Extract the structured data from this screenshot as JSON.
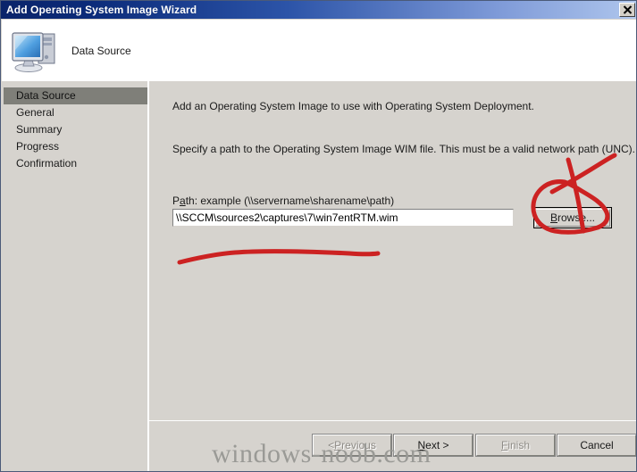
{
  "window": {
    "title": "Add Operating System Image Wizard",
    "close_icon": "close-x-icon"
  },
  "header": {
    "icon": "computer-monitor-icon",
    "title": "Data Source"
  },
  "sidebar": {
    "items": [
      {
        "label": "Data Source",
        "selected": true
      },
      {
        "label": "General",
        "selected": false
      },
      {
        "label": "Summary",
        "selected": false
      },
      {
        "label": "Progress",
        "selected": false
      },
      {
        "label": "Confirmation",
        "selected": false
      }
    ]
  },
  "content": {
    "intro_text": "Add an Operating System Image to use with Operating System Deployment.",
    "specify_text": "Specify a path to the Operating System Image WIM file. This must be a valid network path (UNC).",
    "path_label_before": "P",
    "path_label_accel": "a",
    "path_label_after": "th: example (\\\\servername\\sharename\\path)",
    "path_value": "\\\\SCCM\\sources2\\captures\\7\\win7entRTM.wim",
    "path_placeholder": "\\\\servername\\sharename\\path",
    "browse_accel": "B",
    "browse_label_after": "rowse..."
  },
  "footer": {
    "buttons": [
      {
        "name": "previous",
        "prefix": "< ",
        "accel": "P",
        "suffix": "revious",
        "disabled": true
      },
      {
        "name": "next",
        "prefix": "",
        "accel": "N",
        "suffix": "ext >",
        "disabled": false
      },
      {
        "name": "finish",
        "prefix": "",
        "accel": "F",
        "suffix": "inish",
        "disabled": true
      },
      {
        "name": "cancel",
        "prefix": "",
        "accel": "",
        "suffix": "Cancel",
        "disabled": false
      }
    ]
  },
  "watermark": {
    "text": "windows-noob.com"
  },
  "annotations": {
    "browse_circle": "red-hand-drawn-circle",
    "browse_slash": "red-hand-drawn-slash",
    "path_underline": "red-hand-drawn-underline",
    "color": "#cc2222"
  },
  "colors": {
    "titlebar_start": "#0a246a",
    "titlebar_end": "#b6cbef",
    "dialog_face": "#d6d3ce",
    "selection": "#7f7f79",
    "annotation_red": "#cc2222"
  }
}
